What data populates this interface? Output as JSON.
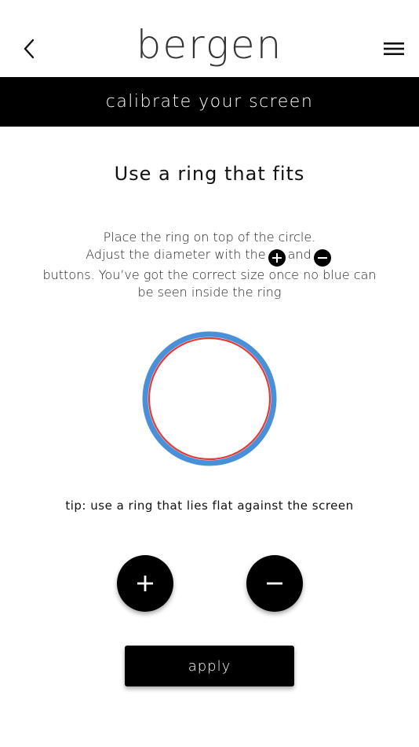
{
  "header": {
    "back_icon": "chevron-left-icon",
    "logo": "bergen",
    "menu_icon": "hamburger-menu-icon"
  },
  "banner": {
    "title": "calibrate your screen"
  },
  "main": {
    "heading": "Use a ring that fits",
    "instructions": {
      "line1": "Place the ring on top of the circle.",
      "line2_before": "Adjust the diameter with the",
      "line2_middle": "and",
      "line3": "buttons. You’ve got the correct size once no blue can be seen inside the ring"
    },
    "ring": {
      "outer_color": "#4a90d9",
      "inner_color": "#e53935"
    },
    "tip": "tip: use a ring that lies flat against the screen",
    "controls": {
      "increase_icon": "plus-icon",
      "decrease_icon": "minus-icon"
    },
    "apply_label": "apply"
  },
  "colors": {
    "background": "#ffffff",
    "banner": "#000000",
    "button": "#000000",
    "button_text": "#ffffff"
  }
}
